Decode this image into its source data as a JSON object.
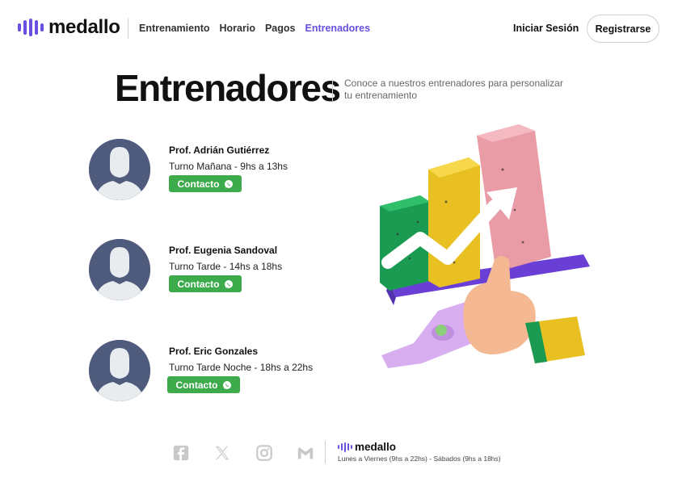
{
  "brand": {
    "name": "medallo",
    "accent_color": "#6a4fe0"
  },
  "nav": {
    "links": [
      {
        "label": "Entrenamiento"
      },
      {
        "label": "Horario"
      },
      {
        "label": "Pagos"
      },
      {
        "label": "Entrenadores",
        "active": true
      }
    ],
    "login_label": "Iniciar Sesión",
    "register_label": "Registrarse"
  },
  "header": {
    "title": "Entrenadores",
    "subtitle": "Conoce a nuestros entrenadores para personalizar tu entrenamiento"
  },
  "trainers": [
    {
      "name": "Prof. Adrián Gutiérrez",
      "shift": "Turno Mañana - 9hs a 13hs",
      "contact_label": "Contacto"
    },
    {
      "name": "Prof. Eugenia Sandoval",
      "shift": "Turno Tarde - 14hs a 18hs",
      "contact_label": "Contacto"
    },
    {
      "name": "Prof. Eric Gonzales",
      "shift": "Turno Tarde Noche - 18hs a 22hs",
      "contact_label": "Contacto"
    }
  ],
  "colors": {
    "contact_button": "#3dab4b",
    "avatar_bg": "#4f5b7d"
  },
  "icons": [
    "facebook-icon",
    "x-icon",
    "instagram-icon",
    "gmail-icon",
    "whatsapp-icon"
  ],
  "footer": {
    "brand": "medallo",
    "hours": "Lunes a Viernes (9hs a 22hs) - Sábados (9hs a 18hs)"
  }
}
